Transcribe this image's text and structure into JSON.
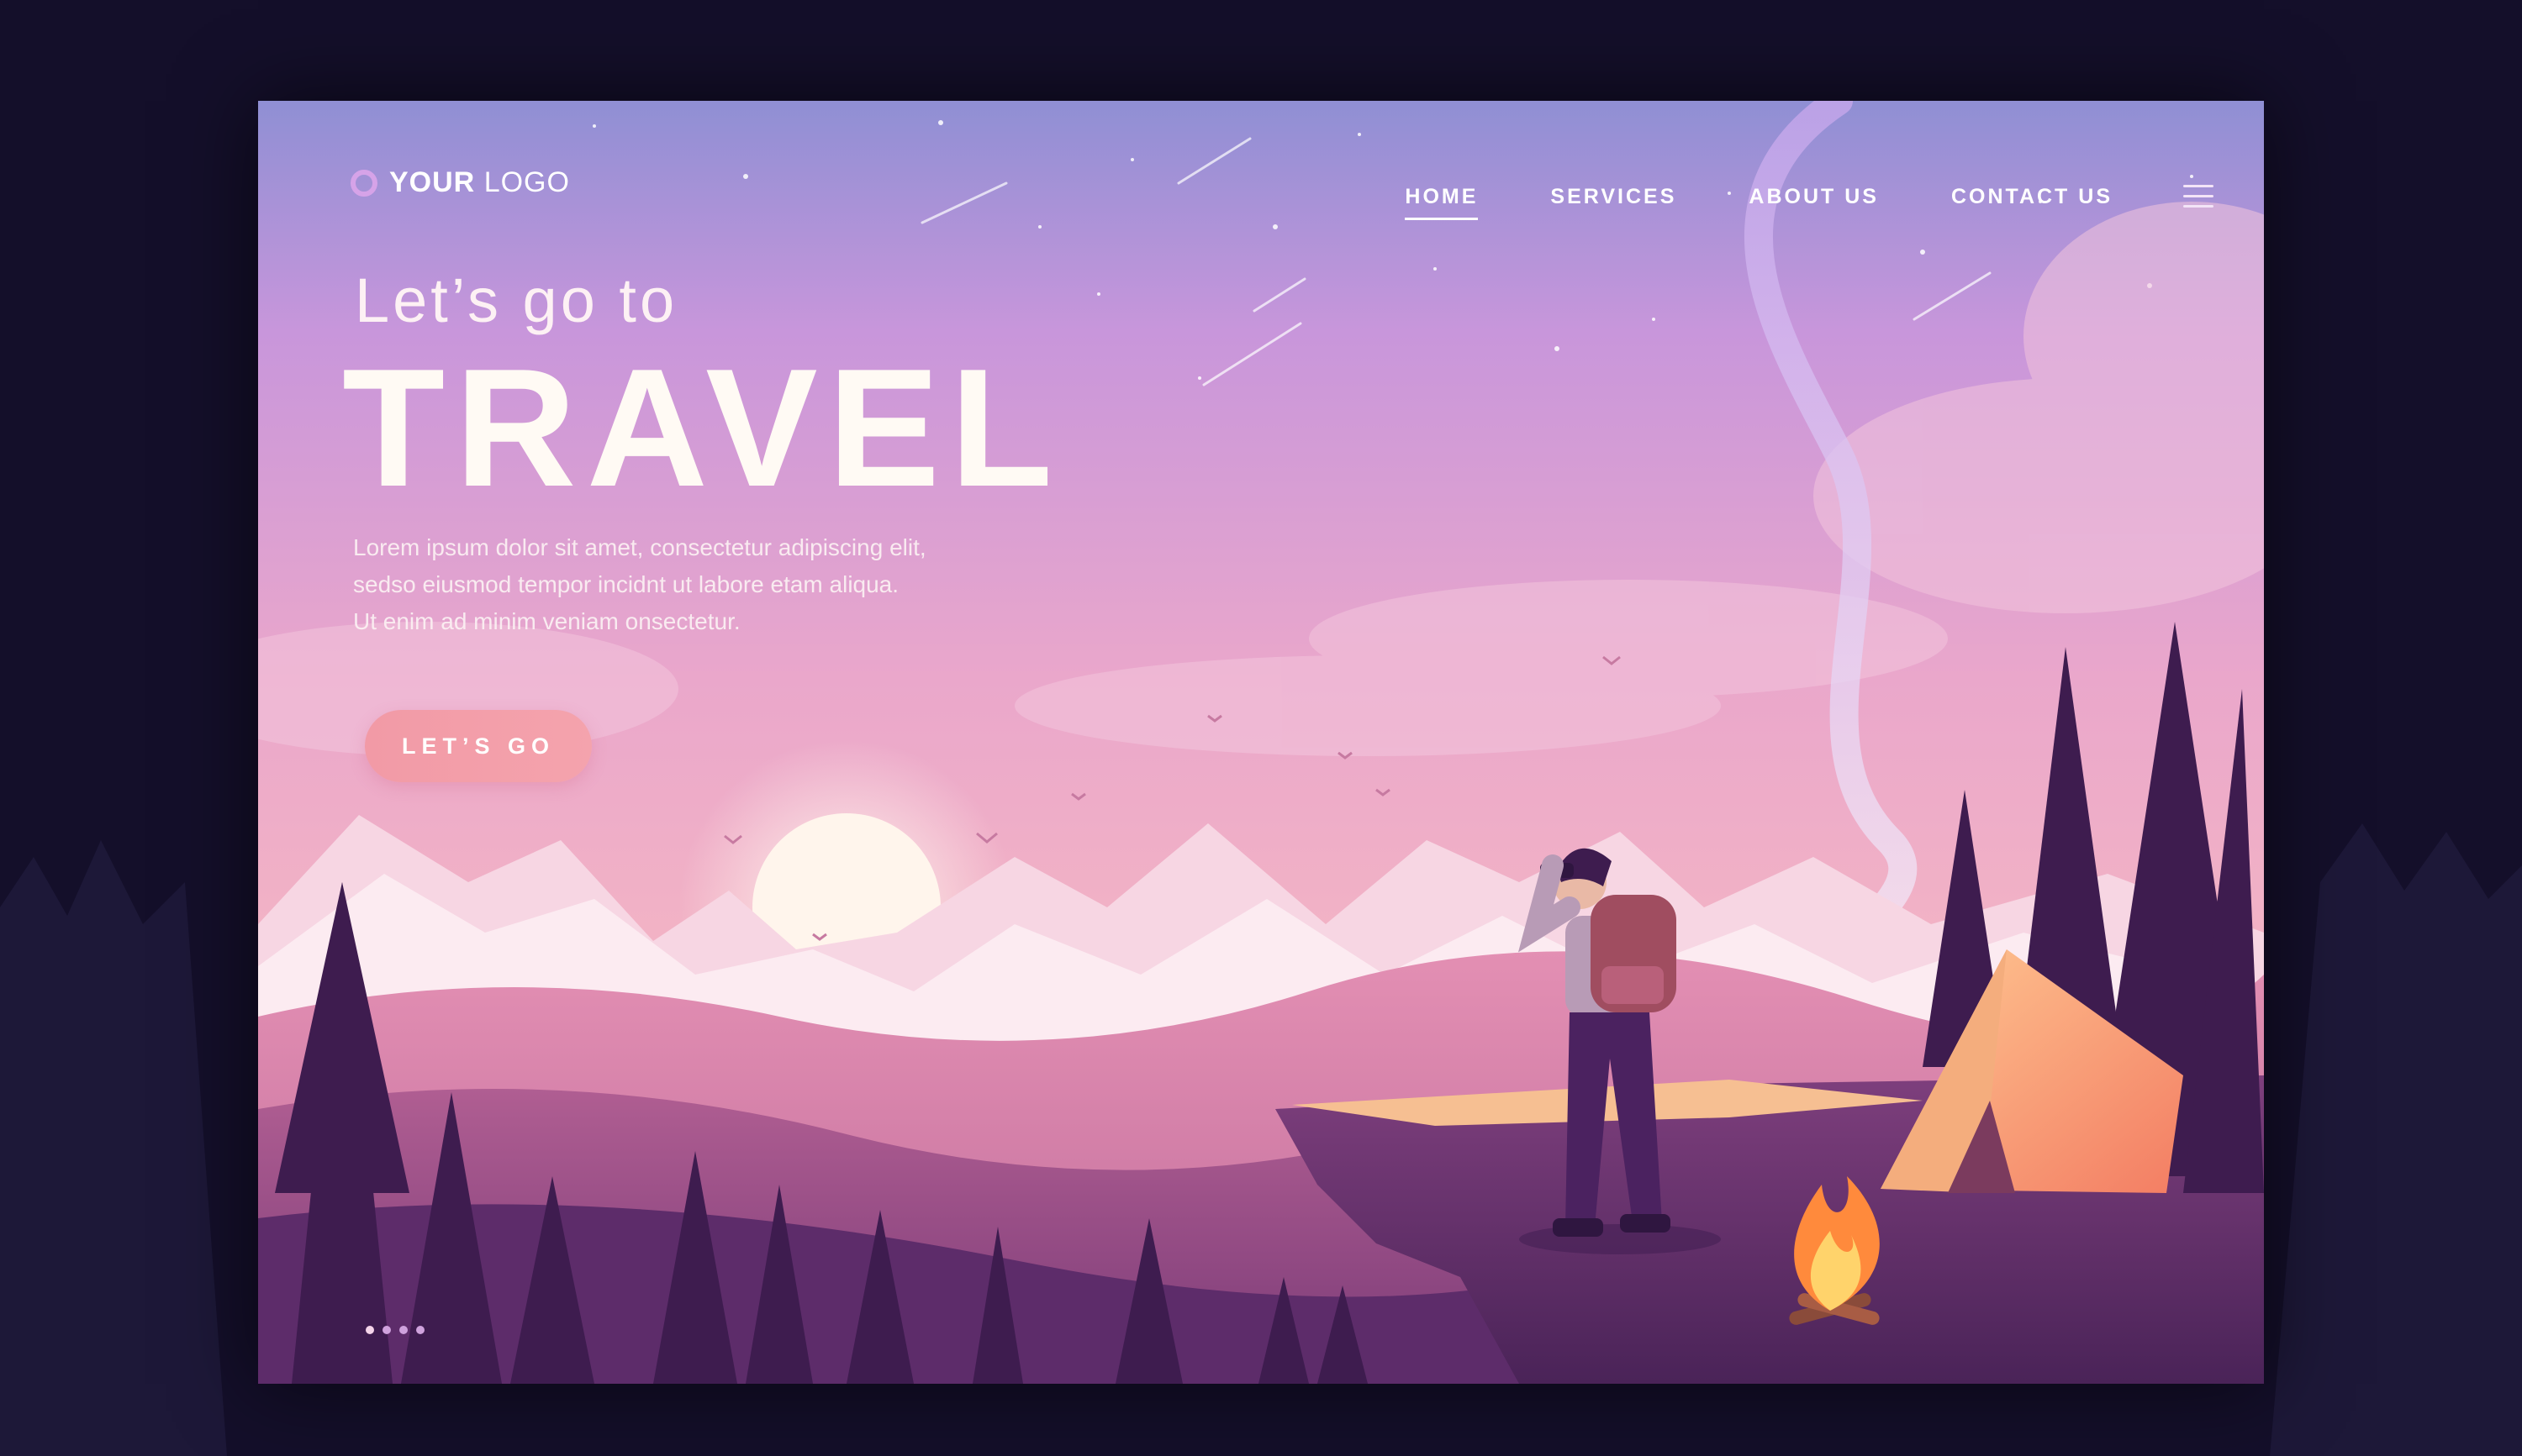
{
  "logo": {
    "bold": "YOUR",
    "light": "LOGO"
  },
  "nav": {
    "items": [
      {
        "label": "HOME",
        "active": true
      },
      {
        "label": "SERVICES",
        "active": false
      },
      {
        "label": "ABOUT US",
        "active": false
      },
      {
        "label": "CONTACT US",
        "active": false
      }
    ],
    "menu_icon": "hamburger-menu-icon"
  },
  "hero": {
    "subtitle": "Let’s go to",
    "title": "TRAVEL",
    "description": [
      "Lorem ipsum dolor sit amet, consectetur adipiscing elit,",
      "sedso eiusmod tempor incidnt ut labore etam aliqua.",
      "Ut enim ad minim veniam onsectetur."
    ],
    "cta_label": "LET’S GO"
  },
  "pagination": {
    "count": 4,
    "active_index": 0
  },
  "colors": {
    "sky_top": "#8f8fd4",
    "sky_mid": "#d99ad6",
    "sky_bottom": "#f5b6c0",
    "forest_dark": "#4a2358",
    "tent": "#f9a56f",
    "fire": "#ff8a3c",
    "page_background": "#140f2a"
  }
}
